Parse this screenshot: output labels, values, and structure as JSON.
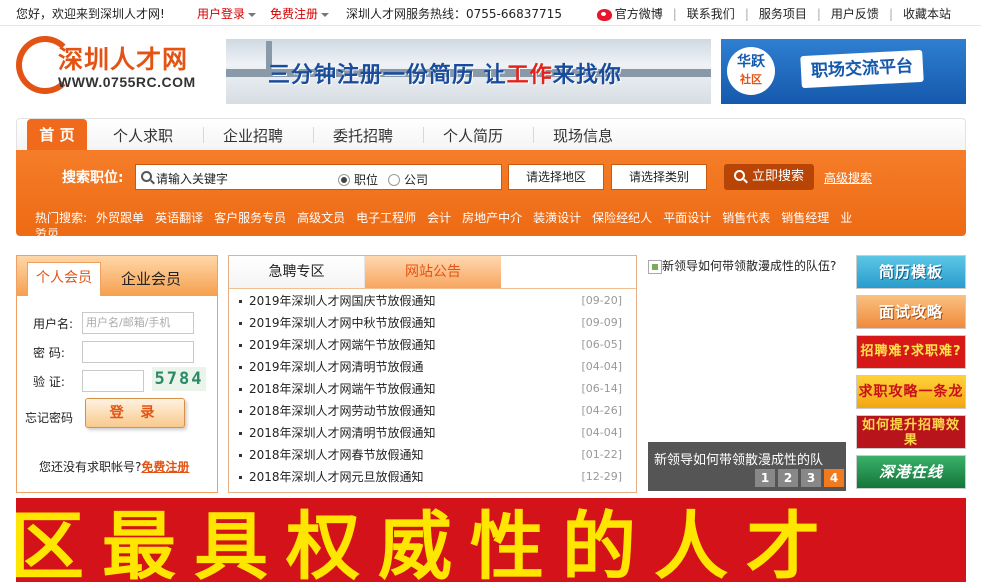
{
  "topbar": {
    "welcome": "您好，欢迎来到深圳人才网!",
    "login": "用户登录",
    "register": "免费注册",
    "hotline": "深圳人才网服务热线：0755-66837715",
    "links": [
      "官方微博",
      "联系我们",
      "服务项目",
      "用户反馈",
      "收藏本站"
    ]
  },
  "logo": {
    "name": "深圳人才网",
    "url": "WWW.0755RC.COM"
  },
  "banners": {
    "left_pre": "三分钟注册一份简历  让",
    "left_hl": "工作",
    "left_post": "来找你",
    "right_badge": "华跃",
    "right_badge_sub": "社区",
    "right_text": "职场交流平台"
  },
  "nav": {
    "home": "首 页",
    "items": [
      "个人求职",
      "企业招聘",
      "委托招聘",
      "个人简历",
      "现场信息"
    ]
  },
  "search": {
    "label": "搜索职位:",
    "placeholder": "请输入关键字",
    "radio_position": "职位",
    "radio_company": "公司",
    "area": "请选择地区",
    "category": "请选择类别",
    "button": "立即搜索",
    "advanced": "高级搜索",
    "hot_label": "热门搜索:",
    "hot": [
      "外贸跟单",
      "英语翻译",
      "客户服务专员",
      "高级文员",
      "电子工程师",
      "会计",
      "房地产中介",
      "装潢设计",
      "保险经纪人",
      "平面设计",
      "销售代表",
      "销售经理",
      "业"
    ],
    "hot_second_line": "务员"
  },
  "login_box": {
    "tab_personal": "个人会员",
    "tab_company": "企业会员",
    "username_label": "用户名:",
    "username_placeholder": "用户名/邮箱/手机",
    "password_label": "密   码:",
    "captcha_label": "验   证:",
    "captcha": "5784",
    "forgot": "忘记密码",
    "login_button": "登 录",
    "no_account": "您还没有求职帐号?",
    "register_link": "免费注册"
  },
  "news": {
    "tab_urgent": "急聘专区",
    "tab_notice": "网站公告",
    "items": [
      {
        "title": "2019年深圳人才网国庆节放假通知",
        "date": "[09-20]"
      },
      {
        "title": "2019年深圳人才网中秋节放假通知",
        "date": "[09-09]"
      },
      {
        "title": "2019年深圳人才网端午节放假通知",
        "date": "[06-05]"
      },
      {
        "title": "2019年深圳人才网清明节放假通",
        "date": "[04-04]"
      },
      {
        "title": "2018年深圳人才网端午节放假通知",
        "date": "[06-14]"
      },
      {
        "title": "2018年深圳人才网劳动节放假通知",
        "date": "[04-26]"
      },
      {
        "title": "2018年深圳人才网清明节放假通知",
        "date": "[04-04]"
      },
      {
        "title": "2018年深圳人才网春节放假通知",
        "date": "[01-22]"
      },
      {
        "title": "2018年深圳人才网元旦放假通知",
        "date": "[12-29]"
      }
    ]
  },
  "slideshow": {
    "alt": "新领导如何带领散漫成性的队伍?",
    "caption": "新领导如何带领散漫成性的队",
    "pages": [
      "1",
      "2",
      "3",
      "4"
    ],
    "active_page": "4"
  },
  "tiles": [
    "简历模板",
    "面试攻略",
    "招聘难?求职难?",
    "求职攻略一条龙",
    "如何提升招聘效果",
    "深港在线"
  ],
  "big_banner": "区最具权威性的人才"
}
